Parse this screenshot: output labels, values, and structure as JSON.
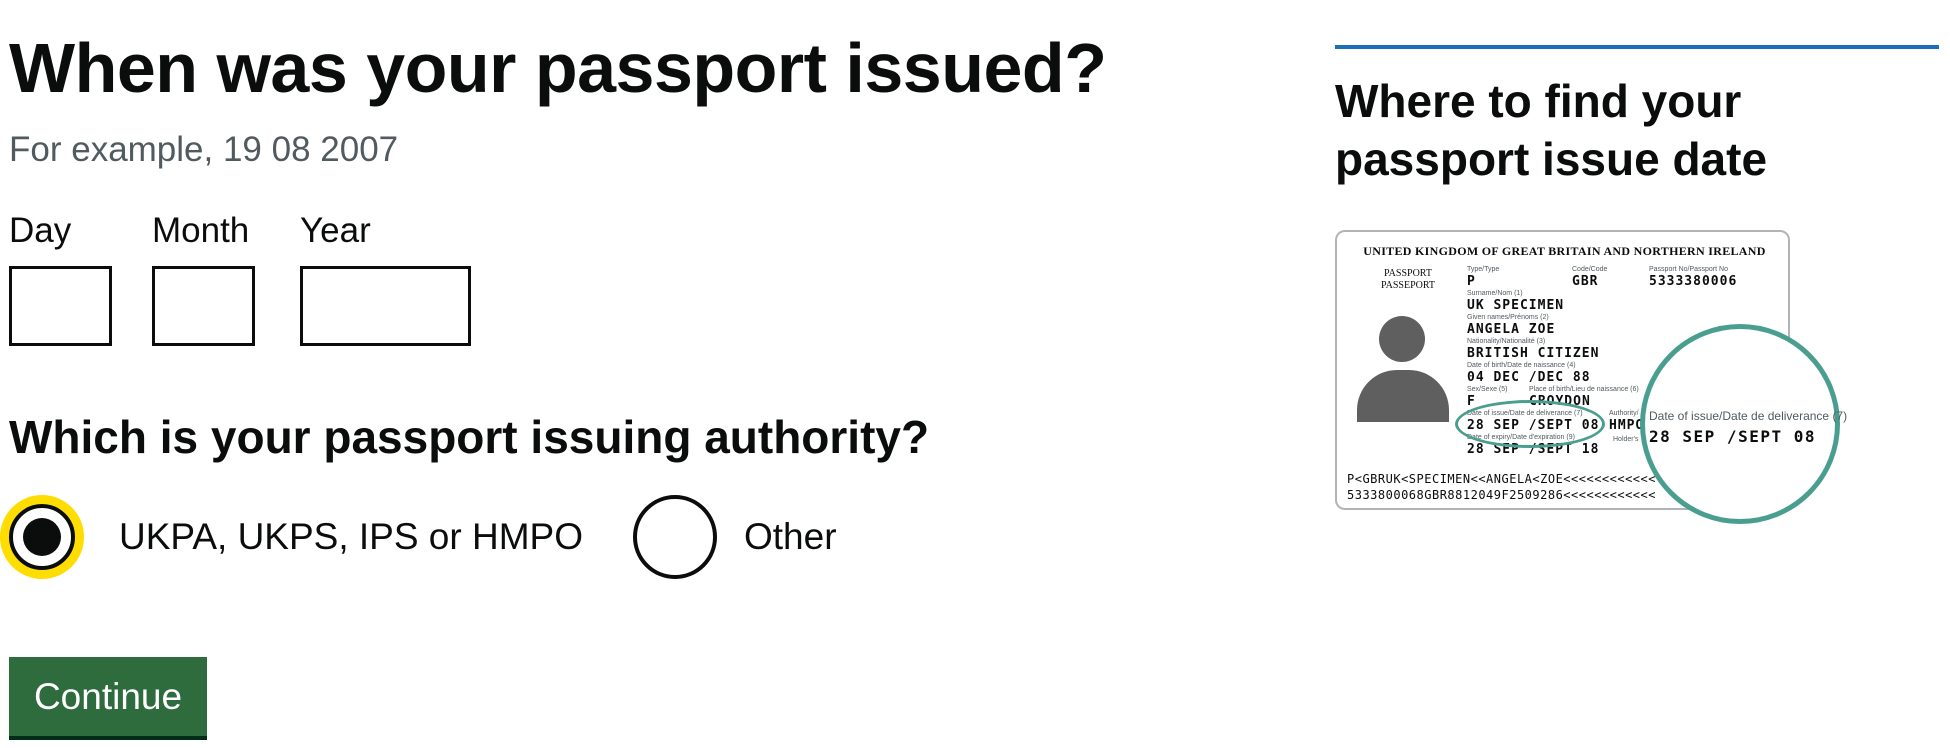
{
  "page": {
    "title": "When was your passport issued?",
    "hint": "For example, 19 08 2007"
  },
  "date_fields": {
    "day_label": "Day",
    "month_label": "Month",
    "year_label": "Year",
    "day_value": "",
    "month_value": "",
    "year_value": ""
  },
  "authority": {
    "question": "Which is your passport issuing authority?",
    "options": [
      {
        "label": "UKPA, UKPS, IPS or HMPO",
        "selected": true,
        "focused": true
      },
      {
        "label": "Other",
        "selected": false,
        "focused": false
      }
    ]
  },
  "actions": {
    "continue_label": "Continue"
  },
  "aside": {
    "title": "Where to find your passport issue date",
    "passport_image": {
      "header": "UNITED KINGDOM OF GREAT BRITAIN AND NORTHERN IRELAND",
      "doc_type": "PASSPORT\nPASSEPORT",
      "type_label": "Type/Type",
      "type_value": "P",
      "code_label": "Code/Code",
      "code_value": "GBR",
      "number_label": "Passport No/Passport No",
      "number_value": "5333380006",
      "surname_label": "Surname/Nom (1)",
      "surname_value": "UK SPECIMEN",
      "given_label": "Given names/Prénoms (2)",
      "given_value": "ANGELA ZOE",
      "nationality_label": "Nationality/Nationalité (3)",
      "nationality_value": "BRITISH CITIZEN",
      "dob_label": "Date of birth/Date de naissance (4)",
      "dob_value": "04 DEC /DEC 88",
      "sex_label": "Sex/Sexe (5)",
      "sex_value": "F",
      "pob_label": "Place of birth/Lieu de naissance (6)",
      "pob_value": "CROYDON",
      "issue_label": "Date of issue/Date de deliverance (7)",
      "issue_value": "28 SEP /SEPT 08",
      "authority_label": "Authority/",
      "authority_value": "HMPO",
      "expiry_label": "Date of expiry/Date d'expiration (9)",
      "expiry_value": "28 SEP /SEPT 18",
      "holder_label": "Holder's",
      "mrz_line1": "P<GBRUK<SPECIMEN<<ANGELA<ZOE<<<<<<<<<<<<",
      "mrz_line2": "5333800068GBR8812049F2509286<<<<<<<<<<<<",
      "magnified_label": "Date of issue/Date de deliverance (7)",
      "magnified_value": "28 SEP /SEPT 08"
    }
  },
  "colors": {
    "text": "#0b0c0c",
    "hint": "#505a5f",
    "focus": "#ffdd00",
    "button": "#2e6b3d",
    "aside_rule": "#1d70b8",
    "highlight": "#4a9e8f"
  }
}
